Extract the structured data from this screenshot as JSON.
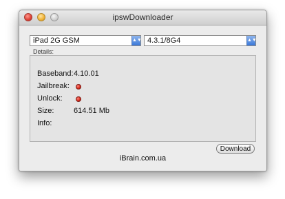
{
  "window": {
    "title": "ipswDownloader"
  },
  "device_select": {
    "value": "iPad 2G GSM"
  },
  "firmware_select": {
    "value": "4.3.1/8G4"
  },
  "details": {
    "label": "Details:",
    "baseband_label": "Baseband:",
    "baseband_value": "4.10.01",
    "jailbreak_label": "Jailbreak:",
    "jailbreak_status": "red",
    "unlock_label": "Unlock:",
    "unlock_status": "red",
    "size_label": "Size:",
    "size_value": "614.51 Mb",
    "info_label": "Info:"
  },
  "download_button": {
    "label": "Download"
  },
  "footer": {
    "text": "iBrain.com.ua"
  },
  "colors": {
    "status_red": "#d62718",
    "select_arrow_blue": "#3a78d8"
  },
  "icons": {
    "close": "close-button-icon",
    "minimize": "minimize-button-icon",
    "zoom": "zoom-button-icon",
    "dropdown": "chevron-updown-icon",
    "status": "red-status-led-icon"
  }
}
